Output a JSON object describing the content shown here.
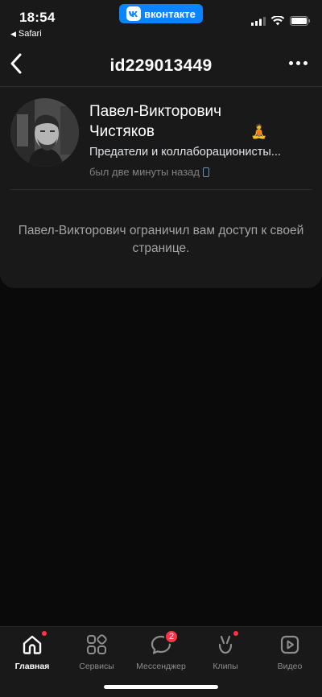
{
  "status_bar": {
    "time": "18:54",
    "back_app": "Safari",
    "app_pill": "вконтакте"
  },
  "nav": {
    "title": "id229013449"
  },
  "profile": {
    "name_line1": "Павел-Викторович",
    "name_line2": "Чистяков",
    "emoji": "🧘",
    "status": "Предатели и коллаборационисты...",
    "online": "был две минуты назад"
  },
  "message": {
    "text": "Павел-Викторович ограничил вам доступ к своей странице."
  },
  "tabs": [
    {
      "label": "Главная",
      "icon": "home-icon",
      "active": true,
      "dot": true
    },
    {
      "label": "Сервисы",
      "icon": "services-icon",
      "active": false
    },
    {
      "label": "Мессенджер",
      "icon": "messenger-icon",
      "active": false,
      "badge": "2"
    },
    {
      "label": "Клипы",
      "icon": "clips-icon",
      "active": false,
      "dot": true
    },
    {
      "label": "Видео",
      "icon": "video-icon",
      "active": false
    }
  ],
  "colors": {
    "background": "#0a0a0a",
    "surface": "#191919",
    "accent": "#0a84ff",
    "badge": "#ff3347"
  }
}
